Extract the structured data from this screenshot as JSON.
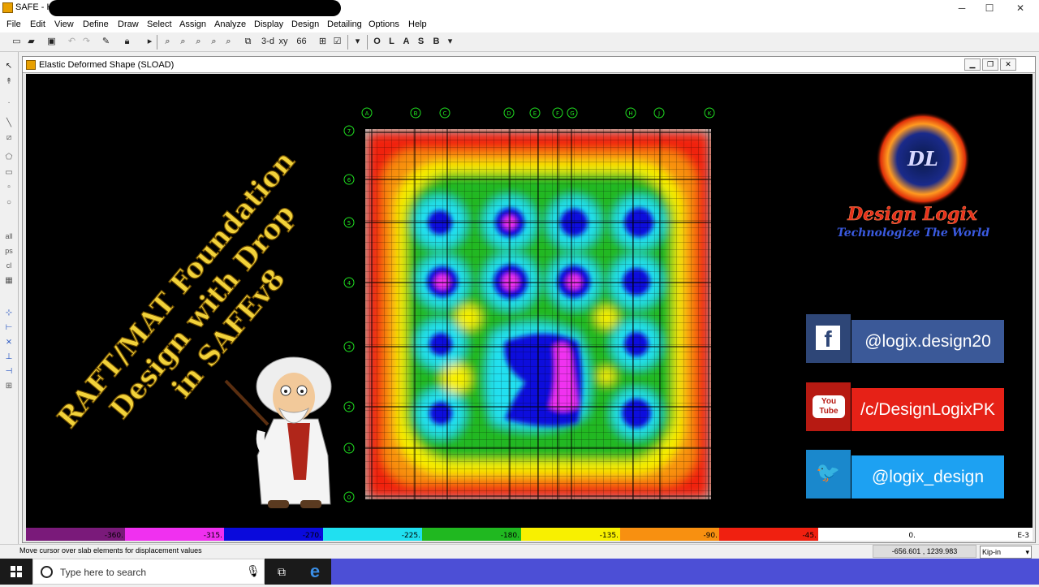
{
  "window": {
    "title": "SAFE - Ho",
    "minimize": "─",
    "maximize": "☐",
    "close": "✕"
  },
  "menu": [
    "File",
    "Edit",
    "View",
    "Define",
    "Draw",
    "Select",
    "Assign",
    "Analyze",
    "Display",
    "Design",
    "Detailing",
    "Options",
    "Help"
  ],
  "toolbar": {
    "view3d": "3-d",
    "viewxy": "xy",
    "design_letters": [
      "O",
      "L",
      "A",
      "S",
      "B"
    ]
  },
  "subwindow": {
    "title": "Elastic Deformed Shape (SLOAD)"
  },
  "grid": {
    "columns": [
      "A",
      "B",
      "C",
      "D",
      "E",
      "F",
      "G",
      "H",
      "J",
      "K"
    ],
    "rows": [
      "7",
      "6",
      "5",
      "4",
      "3",
      "2",
      "1",
      "0"
    ]
  },
  "overlay": {
    "title_lines": [
      "RAFT/MAT Foundation",
      "Design with Drop",
      "in SAFEv8"
    ],
    "brand_monogram": "DL",
    "brand_name": "Design Logix",
    "brand_tagline": "Technologize The World",
    "social": [
      {
        "icon": "facebook-icon",
        "glyph": "f",
        "handle": "@logix.design20",
        "color": "#3b5998",
        "dark": "#2e4677"
      },
      {
        "icon": "youtube-icon",
        "glyph": "You Tube",
        "handle": "/c/DesignLogixPK",
        "color": "#e62117",
        "dark": "#b71a12"
      },
      {
        "icon": "twitter-icon",
        "glyph": "🐦",
        "handle": "@logix_design",
        "color": "#1da1f2",
        "dark": "#1a88cc"
      }
    ]
  },
  "legend": {
    "ticks": [
      "-360.",
      "-315.",
      "-270.",
      "-225.",
      "-180.",
      "-135.",
      "-90.",
      "-45.",
      "0.",
      "E-3"
    ],
    "colors": [
      "#7a1a7a",
      "#f030f0",
      "#0a0adc",
      "#20e0f0",
      "#20b820",
      "#f8f000",
      "#f89010",
      "#f02010",
      "#ffffff"
    ]
  },
  "status": {
    "message": "Move cursor over slab elements for displacement values",
    "coords": "-656.601 , 1239.983",
    "units": "Kip-in"
  },
  "taskbar": {
    "search_placeholder": "Type here to search"
  }
}
